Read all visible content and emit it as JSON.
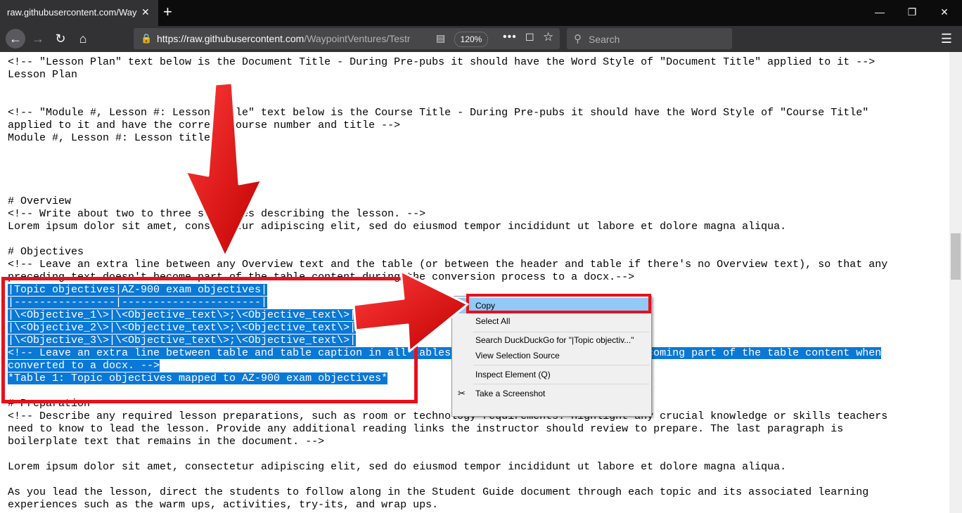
{
  "browser": {
    "tab_title": "raw.githubusercontent.com/Waypo",
    "tab_close": "✕",
    "new_tab": "+",
    "window_controls": {
      "minimize": "—",
      "maximize": "❐",
      "close": "✕"
    },
    "nav": {
      "back": "←",
      "forward": "→",
      "reload": "↻",
      "home": "⌂"
    },
    "url_prefix": "https://raw.githubusercontent.com",
    "url_rest": "/WaypointVentures/Testrepo",
    "zoom_level": "120%",
    "page_actions": "•••",
    "search_placeholder": "Search",
    "menu_icon": "☰"
  },
  "document": {
    "lines": [
      "<!-- \"Lesson Plan\" text below is the Document Title - During Pre-pubs it should have the Word Style of \"Document Title\" applied to it -->",
      "Lesson Plan",
      "",
      "",
      "<!-- \"Module #, Lesson #: Lesson title\" text below is the Course Title - During Pre-pubs it should have the Word Style of \"Course Title\"",
      "applied to it and have the correct course number and title -->",
      "Module #, Lesson #: Lesson title",
      "",
      "",
      "",
      "",
      "# Overview",
      "<!-- Write about two to three sentences describing the lesson. -->",
      "Lorem ipsum dolor sit amet, consectetur adipiscing elit, sed do eiusmod tempor incididunt ut labore et dolore magna aliqua.",
      "",
      "# Objectives",
      "<!-- Leave an extra line between any Overview text and the table (or between the header and table if there's no Overview text), so that any",
      "preceding text doesn't become part of the table content during the conversion process to a docx.-->"
    ],
    "selected_lines": [
      "|Topic objectives|AZ-900 exam objectives|",
      "|----------------|----------------------|",
      "|\\<Objective_1\\>|\\<Objective_text\\>;\\<Objective_text\\>|",
      "|\\<Objective_2\\>|\\<Objective_text\\>;\\<Objective_text\\>|",
      "|\\<Objective_3\\>|\\<Objective_text\\>;\\<Objective_text\\>|",
      "<!-- Leave an extra line between table and table caption in all tables to prevent the caption from becoming part of the table content when",
      "converted to a docx. -->",
      "*Table 1: Topic objectives mapped to AZ-900 exam objectives*"
    ],
    "after_lines": [
      "",
      "# Preparation",
      "<!-- Describe any required lesson preparations, such as room or technology requirements. Highlight any crucial knowledge or skills teachers",
      "need to know to lead the lesson. Provide any additional reading links the instructor should review to prepare. The last paragraph is",
      "boilerplate text that remains in the document. -->",
      "",
      "Lorem ipsum dolor sit amet, consectetur adipiscing elit, sed do eiusmod tempor incididunt ut labore et dolore magna aliqua.",
      "",
      "As you lead the lesson, direct the students to follow along in the Student Guide document through each topic and its associated learning",
      "experiences such as the warm ups, activities, try-its, and wrap ups."
    ]
  },
  "context_menu": {
    "items": [
      {
        "label": "Copy",
        "active": true
      },
      {
        "label": "Select All"
      },
      {
        "label": "Search DuckDuckGo for \"|Topic objectiv...\""
      },
      {
        "label": "View Selection Source"
      },
      {
        "label": "Inspect Element (Q)"
      },
      {
        "label": "Take a Screenshot",
        "icon": "scissors-icon"
      }
    ]
  },
  "annotations": {
    "highlight_color": "#e8101b",
    "arrow_color": "#e8101b",
    "selection_color": "#0a78d7"
  }
}
